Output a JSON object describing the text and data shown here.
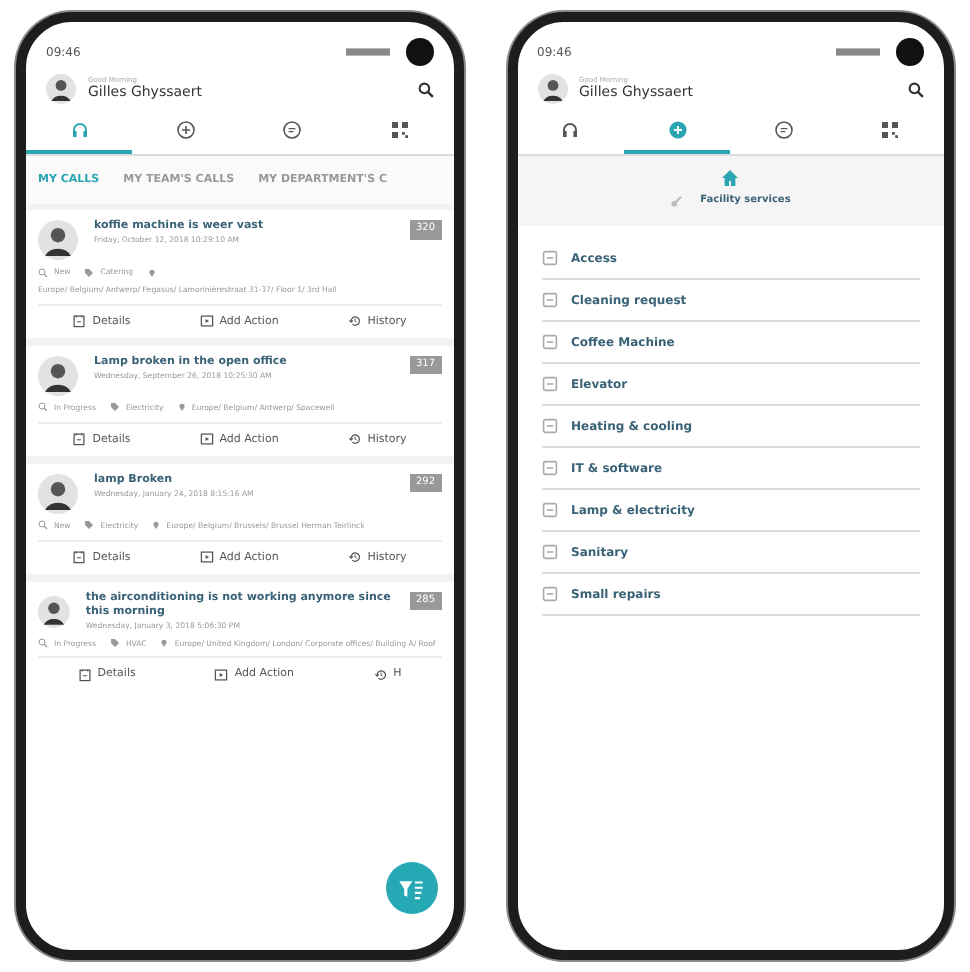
{
  "left_screen": {
    "status_time": "09:46",
    "greeting": "Good Morning",
    "user": "Gilles Ghyssaert",
    "nav_tabs": [
      {
        "kind": "headset",
        "selected": true
      },
      {
        "kind": "plus",
        "selected": false
      },
      {
        "kind": "chat",
        "selected": false
      },
      {
        "kind": "qr",
        "selected": false
      }
    ],
    "sub_tabs": [
      {
        "label": "MY CALLS",
        "selected": true
      },
      {
        "label": "MY TEAM'S CALLS",
        "selected": false
      },
      {
        "label": "MY DEPARTMENT'S C",
        "selected": false
      }
    ],
    "calls": [
      {
        "title": "koffie machine is weer vast",
        "date": "Friday, October 12, 2018 10:29:10 AM",
        "number": "320",
        "status": "New",
        "category": "Catering",
        "location": "Europe/ Belgium/ Antwerp/ Pegasus/ Lamorinièrestraat 31-37/ Floor 1/ 3rd Hall",
        "actions": [
          "Details",
          "Add Action",
          "History"
        ]
      },
      {
        "title": "Lamp broken in the open office",
        "date": "Wednesday, September 26, 2018 10:25:30 AM",
        "number": "317",
        "status": "In Progress",
        "category": "Electricity",
        "location": "Europe/ Belgium/ Antwerp/ Spacewell",
        "actions": [
          "Details",
          "Add Action",
          "History"
        ]
      },
      {
        "title": "lamp Broken",
        "date": "Wednesday, January 24, 2018 8:15:16 AM",
        "number": "292",
        "status": "New",
        "category": "Electricity",
        "location": "Europe/ Belgium/ Brussels/ Brussel Herman Teirlinck",
        "actions": [
          "Details",
          "Add Action",
          "History"
        ]
      },
      {
        "title": "the airconditioning is not working anymore since this morning",
        "date": "Wednesday, January 3, 2018 5:06:30 PM",
        "number": "285",
        "status": "In Progress",
        "category": "HVAC",
        "location": "Europe/ United Kingdom/ London/ Corporate offices/ Building A/ Roof",
        "actions": [
          "Details",
          "Add Action",
          "H"
        ]
      }
    ]
  },
  "right_screen": {
    "status_time": "09:46",
    "greeting": "Good Morning",
    "user": "Gilles Ghyssaert",
    "nav_tabs": [
      {
        "kind": "headset",
        "selected": false
      },
      {
        "kind": "plus",
        "selected": true
      },
      {
        "kind": "chat",
        "selected": false
      },
      {
        "kind": "qr",
        "selected": false
      }
    ],
    "breadcrumb": "Facility services",
    "categories": [
      "Access",
      "Cleaning request",
      "Coffee Machine",
      "Elevator",
      "Heating & cooling",
      "IT & software",
      "Lamp & electricity",
      "Sanitary",
      "Small repairs"
    ]
  }
}
